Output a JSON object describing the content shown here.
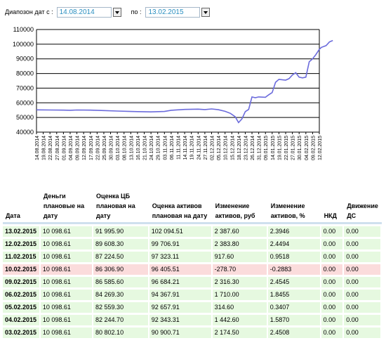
{
  "filter": {
    "from_label": "Диапозон дат с :",
    "from_value": "14.08.2014",
    "to_label": "по :",
    "to_value": "13.02.2015"
  },
  "chart_data": {
    "type": "line",
    "title": "",
    "xlabel": "",
    "ylabel": "",
    "ylim": [
      40000,
      110000
    ],
    "yticks": [
      40000,
      50000,
      60000,
      70000,
      80000,
      90000,
      100000,
      110000
    ],
    "xticks": [
      "14.08.2014",
      "19.08.2014",
      "22.08.2014",
      "27.08.2014",
      "01.09.2014",
      "04.09.2014",
      "09.09.2014",
      "12.09.2014",
      "17.09.2014",
      "22.09.2014",
      "25.09.2014",
      "30.09.2014",
      "03.10.2014",
      "08.10.2014",
      "13.10.2014",
      "16.10.2014",
      "21.10.2014",
      "24.10.2014",
      "29.10.2014",
      "03.11.2014",
      "06.11.2014",
      "11.11.2014",
      "14.11.2014",
      "19.11.2014",
      "24.11.2014",
      "27.11.2014",
      "02.12.2014",
      "05.12.2014",
      "10.12.2014",
      "15.12.2014",
      "18.12.2014",
      "23.12.2014",
      "26.12.2014",
      "31.12.2014",
      "09.01.2015",
      "14.01.2015",
      "19.01.2015",
      "22.01.2015",
      "27.01.2015",
      "30.01.2015",
      "04.02.2015",
      "09.02.2015",
      "12.02.2015"
    ],
    "grid": true,
    "color": "#6b6bdc",
    "series": [
      {
        "values": [
          [
            0,
            55200
          ],
          [
            2,
            55100
          ],
          [
            4,
            55000
          ],
          [
            5,
            54900
          ],
          [
            6,
            55100
          ],
          [
            8,
            55000
          ],
          [
            10,
            54700
          ],
          [
            12,
            54400
          ],
          [
            14,
            54100
          ],
          [
            15,
            54000
          ],
          [
            17,
            53800
          ],
          [
            19,
            54100
          ],
          [
            20,
            54900
          ],
          [
            22,
            55500
          ],
          [
            24,
            55700
          ],
          [
            25,
            55400
          ],
          [
            26,
            55800
          ],
          [
            27,
            55300
          ],
          [
            28,
            54200
          ],
          [
            28.8,
            52800
          ],
          [
            29.5,
            50500
          ],
          [
            30,
            46500
          ],
          [
            30.5,
            49000
          ],
          [
            31,
            54000
          ],
          [
            31.5,
            55500
          ],
          [
            32,
            64000
          ],
          [
            32.5,
            63500
          ],
          [
            33,
            64000
          ],
          [
            34,
            63800
          ],
          [
            34.5,
            65500
          ],
          [
            35,
            67000
          ],
          [
            35.5,
            74000
          ],
          [
            36,
            76000
          ],
          [
            37,
            75500
          ],
          [
            37.5,
            76500
          ],
          [
            38,
            79000
          ],
          [
            38.5,
            80500
          ],
          [
            39,
            77500
          ],
          [
            39.5,
            77000
          ],
          [
            40,
            77500
          ],
          [
            40.5,
            88000
          ],
          [
            41,
            90000
          ],
          [
            41.5,
            93000
          ],
          [
            42,
            96500
          ],
          [
            42.3,
            97800
          ],
          [
            43,
            99000
          ],
          [
            43.5,
            101500
          ],
          [
            44,
            102500
          ]
        ]
      }
    ]
  },
  "table": {
    "headers": [
      "Дата",
      "Деньги плановые на дату",
      "Оценка ЦБ плановая на дату",
      "Оценка активов плановая на дату",
      "Изменение активов, руб",
      "Изменение активов, %",
      "НКД",
      "Движение ДС"
    ],
    "rows": [
      [
        "13.02.2015",
        "10 098.61",
        "91 995.90",
        "102 094.51",
        "2 387.60",
        "2.3946",
        "0.00",
        "0.00"
      ],
      [
        "12.02.2015",
        "10 098.61",
        "89 608.30",
        "99 706.91",
        "2 383.80",
        "2.4494",
        "0.00",
        "0.00"
      ],
      [
        "11.02.2015",
        "10 098.61",
        "87 224.50",
        "97 323.11",
        "917.60",
        "0.9518",
        "0.00",
        "0.00"
      ],
      [
        "10.02.2015",
        "10 098.61",
        "86 306.90",
        "96 405.51",
        "-278.70",
        "-0.2883",
        "0.00",
        "0.00"
      ],
      [
        "09.02.2015",
        "10 098.61",
        "86 585.60",
        "96 684.21",
        "2 316.30",
        "2.4545",
        "0.00",
        "0.00"
      ],
      [
        "06.02.2015",
        "10 098.61",
        "84 269.30",
        "94 367.91",
        "1 710.00",
        "1.8455",
        "0.00",
        "0.00"
      ],
      [
        "05.02.2015",
        "10 098.61",
        "82 559.30",
        "92 657.91",
        "314.60",
        "0.3407",
        "0.00",
        "0.00"
      ],
      [
        "04.02.2015",
        "10 098.61",
        "82 244.70",
        "92 343.31",
        "1 442.60",
        "1.5870",
        "0.00",
        "0.00"
      ],
      [
        "03.02.2015",
        "10 098.61",
        "80 802.10",
        "90 900.71",
        "2 174.50",
        "2.4508",
        "0.00",
        "0.00"
      ]
    ]
  },
  "colors": {
    "positive_row": "#e6f9e0",
    "negative_row": "#fbdcdc",
    "header_rule": "#cfe0ee",
    "line": "#6b6bdc"
  }
}
